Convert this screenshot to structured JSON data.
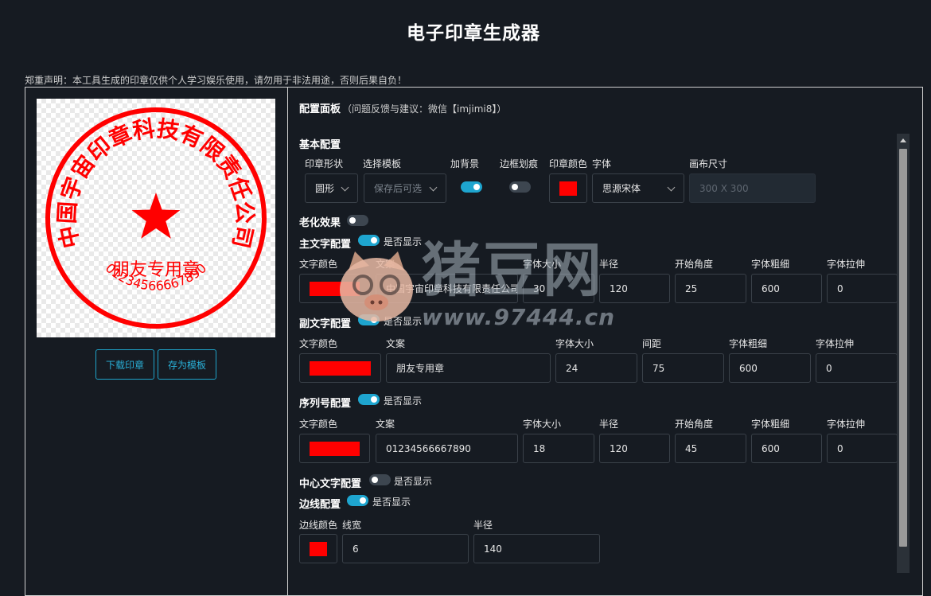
{
  "page": {
    "title": "电子印章生成器",
    "notice": "郑重声明：本工具生成的印章仅供个人学习娱乐使用，请勿用于非法用途，否则后果自负！"
  },
  "stamp": {
    "main_text": "中国宇宙印章科技有限责任公司",
    "sub_text": "朋友专用章",
    "serial": "01234566667890",
    "color": "#ff0000"
  },
  "buttons": {
    "download": "下载印章",
    "save_template": "存为模板"
  },
  "panel": {
    "title": "配置面板",
    "feedback": "（问题反馈与建议：微信【imjimi8】）"
  },
  "basic": {
    "title": "基本配置",
    "labels": {
      "shape": "印章形状",
      "template": "选择模板",
      "bg": "加背景",
      "border_scratch": "边框划痕",
      "color": "印章颜色",
      "font": "字体",
      "canvas": "画布尺寸"
    },
    "shape_value": "圆形",
    "template_placeholder": "保存后可选",
    "bg_on": true,
    "border_scratch_on": false,
    "font_value": "思源宋体",
    "canvas_placeholder": "300 X 300"
  },
  "aging": {
    "title": "老化效果",
    "on": false
  },
  "show_label": "是否显示",
  "main_cfg": {
    "title": "主文字配置",
    "on": true,
    "labels": {
      "color": "文字颜色",
      "text": "文案",
      "size": "字体大小",
      "radius": "半径",
      "start": "开始角度",
      "weight": "字体粗细",
      "stretch": "字体拉伸"
    },
    "text": "中国宇宙印章科技有限责任公司",
    "size": "30",
    "radius": "120",
    "start": "25",
    "weight": "600",
    "stretch": "0"
  },
  "sub_cfg": {
    "title": "副文字配置",
    "on": true,
    "labels": {
      "color": "文字颜色",
      "text": "文案",
      "size": "字体大小",
      "gap": "间距",
      "weight": "字体粗细",
      "stretch": "字体拉伸"
    },
    "text": "朋友专用章",
    "size": "24",
    "gap": "75",
    "weight": "600",
    "stretch": "0"
  },
  "serial_cfg": {
    "title": "序列号配置",
    "on": true,
    "labels": {
      "color": "文字颜色",
      "text": "文案",
      "size": "字体大小",
      "radius": "半径",
      "start": "开始角度",
      "weight": "字体粗细",
      "stretch": "字体拉伸"
    },
    "text": "01234566667890",
    "size": "18",
    "radius": "120",
    "start": "45",
    "weight": "600",
    "stretch": "0"
  },
  "center_cfg": {
    "title": "中心文字配置",
    "on": false
  },
  "border_cfg": {
    "title": "边线配置",
    "on": true,
    "labels": {
      "color": "边线颜色",
      "width": "线宽",
      "radius": "半径"
    },
    "width": "6",
    "radius": "140"
  },
  "watermark": {
    "brand": "猪豆网",
    "url": "www.97444.cn"
  }
}
